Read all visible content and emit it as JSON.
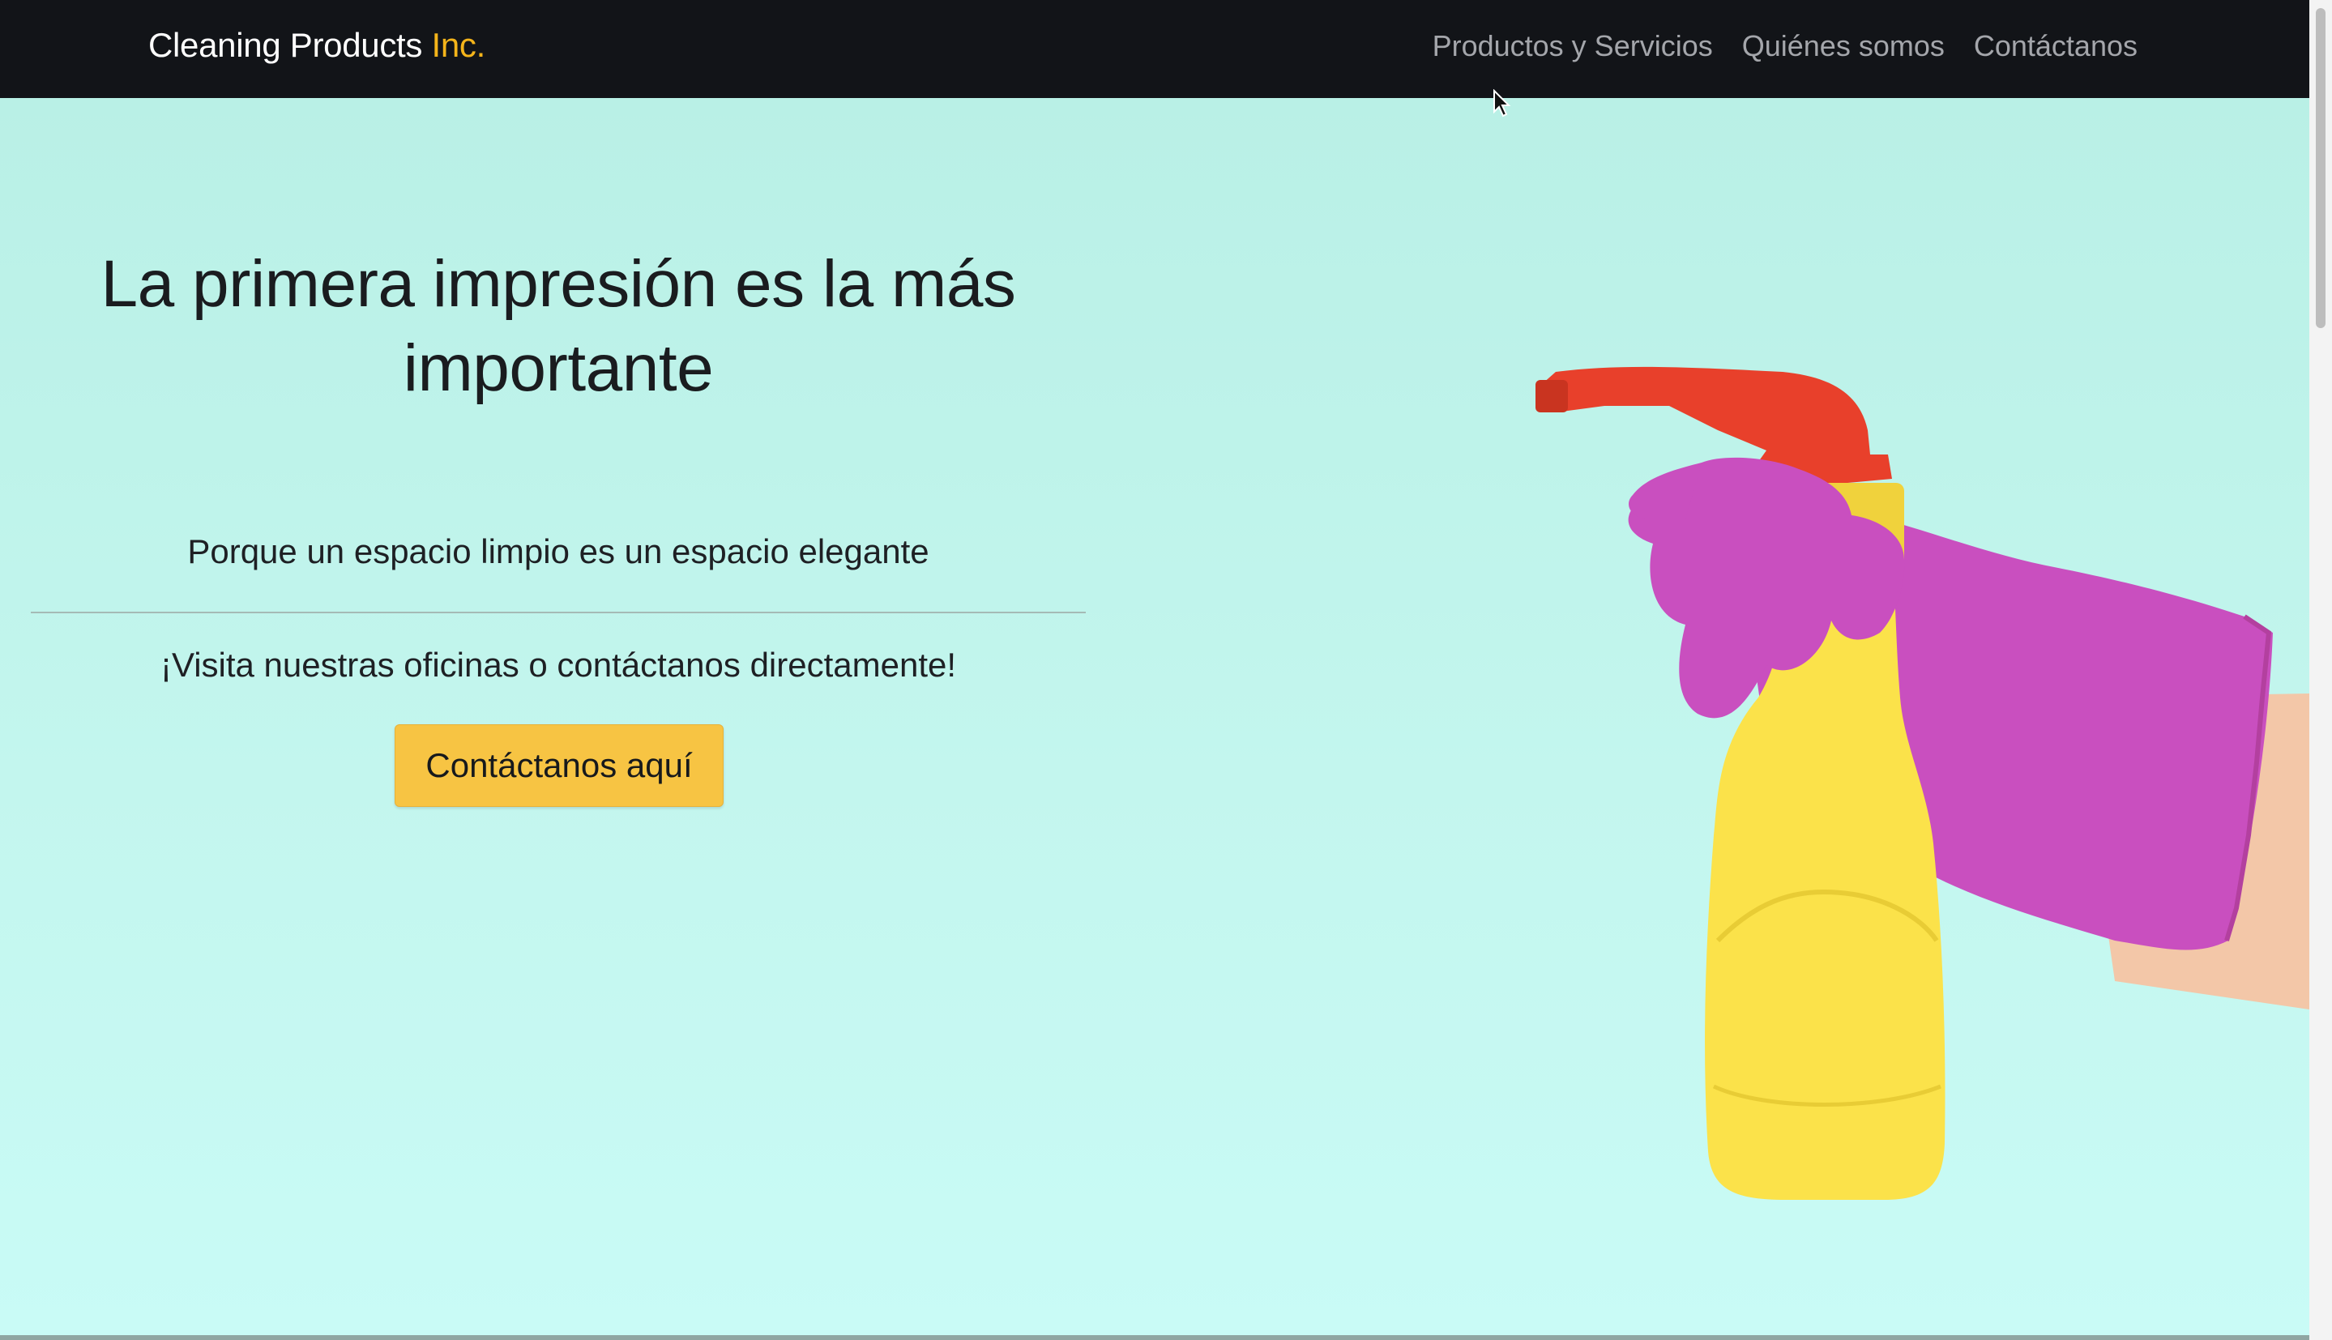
{
  "navbar": {
    "brand_main": "Cleaning Products",
    "brand_accent": "Inc.",
    "links": [
      {
        "label": "Productos y Servicios"
      },
      {
        "label": "Quiénes somos"
      },
      {
        "label": "Contáctanos"
      }
    ]
  },
  "hero": {
    "title": "La primera impresión es la más importante",
    "subtitle": "Porque un espacio limpio es un espacio elegante",
    "visit_text": "¡Visita nuestras oficinas o contáctanos directamente!",
    "cta_label": "Contáctanos aquí",
    "image_icon": "hand-spray-bottle-image"
  },
  "colors": {
    "navbar_bg": "#121418",
    "accent": "#f4b41a",
    "hero_bg": "#bff2ea",
    "button_bg": "#f7c443",
    "glove": "#c94fbf",
    "bottle": "#fbe24a",
    "trigger": "#e8402b"
  }
}
